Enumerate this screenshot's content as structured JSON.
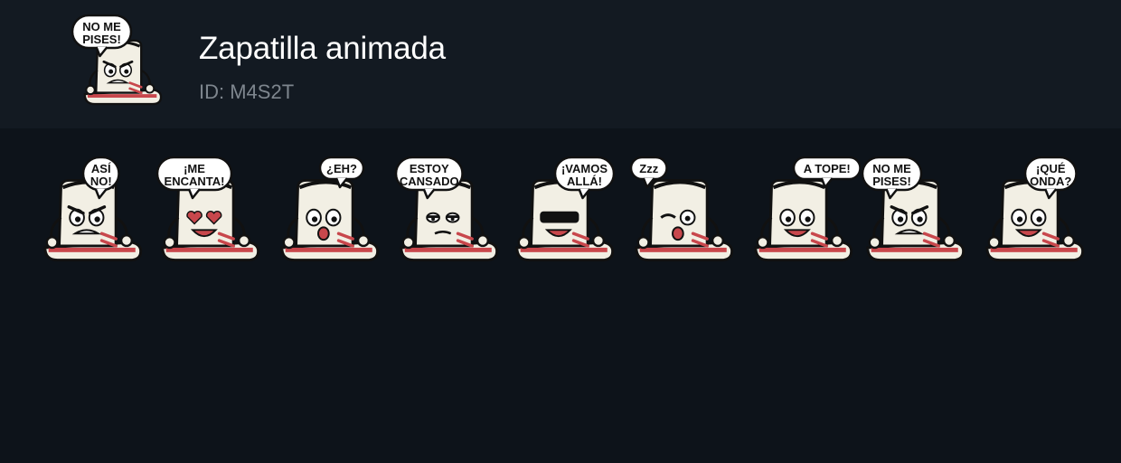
{
  "pack": {
    "title": "Zapatilla animada",
    "id_text": "ID: M4S2T",
    "icon_caption": [
      "NO ME",
      "PISES!"
    ]
  },
  "stickers": [
    {
      "caption": [
        "ASÍ",
        "NO!"
      ],
      "expression": "angry"
    },
    {
      "caption": [
        "¡ME",
        "ENCANTA!"
      ],
      "expression": "love"
    },
    {
      "caption": [
        "¿EH?"
      ],
      "expression": "confused"
    },
    {
      "caption": [
        "ESTOY",
        "CANSADO"
      ],
      "expression": "tired"
    },
    {
      "caption": [
        "¡VAMOS",
        "ALLÁ!"
      ],
      "expression": "cool"
    },
    {
      "caption": [
        "Zzz"
      ],
      "expression": "sleepy"
    },
    {
      "caption": [
        "A TOPE!"
      ],
      "expression": "happy"
    },
    {
      "caption": [
        "NO ME",
        "PISES!"
      ],
      "expression": "angry"
    },
    {
      "caption": [
        "¡QUÉ",
        "ONDA?"
      ],
      "expression": "happy"
    }
  ],
  "colors": {
    "background": "#0d131a",
    "header": "#131a22",
    "shoe": "#f2efe4",
    "outline": "#111111",
    "accent": "#c8474c"
  }
}
